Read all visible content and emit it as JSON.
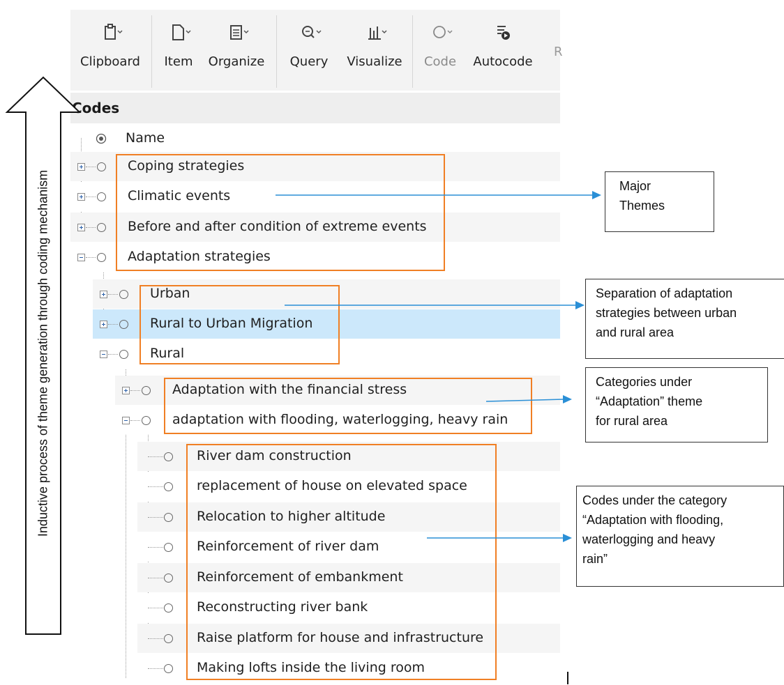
{
  "ribbon": {
    "tools": [
      {
        "label": "Clipboard",
        "icon": "clipboard-icon",
        "enabled": true
      },
      {
        "label": "Item",
        "icon": "item-icon",
        "enabled": true
      },
      {
        "label": "Organize",
        "icon": "organize-icon",
        "enabled": true
      },
      {
        "label": "Query",
        "icon": "query-icon",
        "enabled": true
      },
      {
        "label": "Visualize",
        "icon": "visualize-icon",
        "enabled": true
      },
      {
        "label": "Code",
        "icon": "code-icon",
        "enabled": false
      },
      {
        "label": "Autocode",
        "icon": "autocode-icon",
        "enabled": true
      }
    ],
    "truncated_label": "R"
  },
  "codes": {
    "title": "Codes",
    "column_name": "Name",
    "rows": [
      {
        "label": "Coping strategies",
        "expander": "plus",
        "level": 0
      },
      {
        "label": "Climatic events",
        "expander": "plus",
        "level": 0
      },
      {
        "label": "Before and after condition of extreme events",
        "expander": "plus",
        "level": 0
      },
      {
        "label": "Adaptation strategies",
        "expander": "minus",
        "level": 0
      },
      {
        "label": "Urban",
        "expander": "plus",
        "level": 1
      },
      {
        "label": "Rural to Urban Migration",
        "expander": "plus",
        "level": 1,
        "selected": true
      },
      {
        "label": "Rural",
        "expander": "minus",
        "level": 1
      },
      {
        "label": "Adaptation with the financial stress",
        "expander": "plus",
        "level": 2
      },
      {
        "label": "adaptation with flooding, waterlogging, heavy rain",
        "expander": "minus",
        "level": 2
      },
      {
        "label": "River dam construction",
        "level": 3
      },
      {
        "label": "replacement of house on elevated space",
        "level": 3
      },
      {
        "label": "Relocation to higher altitude",
        "level": 3
      },
      {
        "label": "Reinforcement of river dam",
        "level": 3
      },
      {
        "label": "Reinforcement of embankment",
        "level": 3
      },
      {
        "label": "Reconstructing river bank",
        "level": 3
      },
      {
        "label": "Raise platform for house and infrastructure",
        "level": 3
      },
      {
        "label": "Making lofts inside the living room",
        "level": 3
      }
    ]
  },
  "annotations": {
    "vertical_label": "Inductive process of theme generation through coding mechanism",
    "callouts": [
      {
        "lines": [
          "Major",
          "Themes"
        ]
      },
      {
        "lines": [
          "Separation of adaptation",
          "strategies between urban",
          "and rural area"
        ]
      },
      {
        "lines": [
          "Categories under",
          "“Adaptation” theme",
          "for rural area"
        ]
      },
      {
        "lines": [
          "Codes under the category",
          "“Adaptation with flooding,",
          "waterlogging and heavy",
          "rain”"
        ]
      }
    ]
  },
  "colors": {
    "highlight_box": "#f07f24",
    "arrow": "#2a8fd6",
    "selected_row": "#cce8fb"
  }
}
